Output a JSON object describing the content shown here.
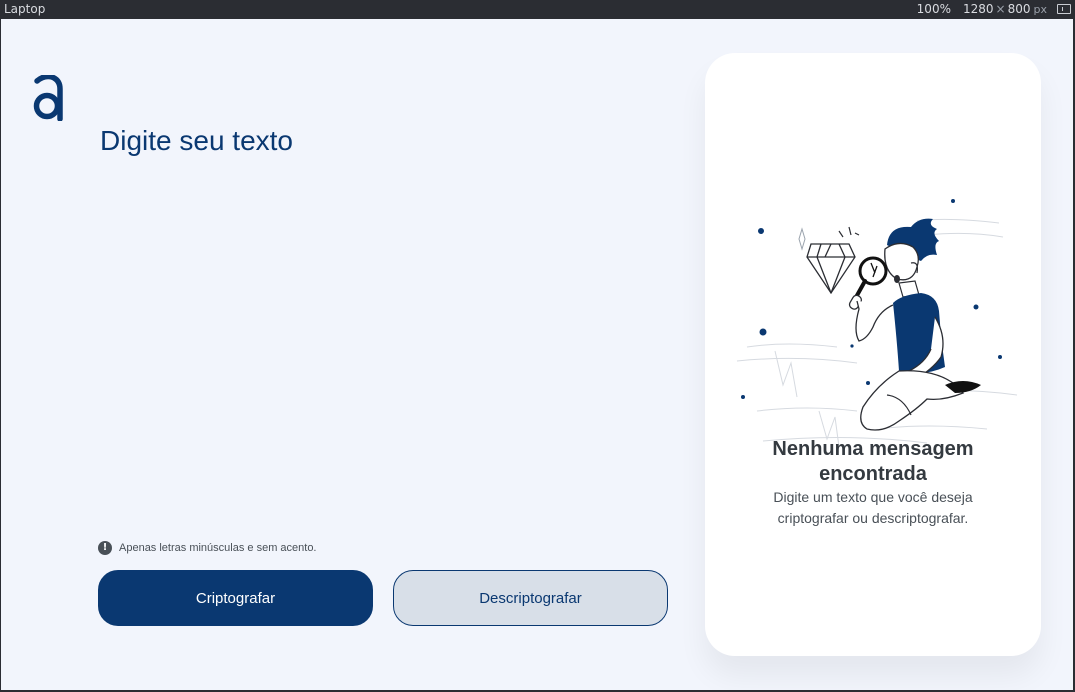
{
  "devtools": {
    "device": "Laptop",
    "zoom": "100%",
    "width": "1280",
    "times": "×",
    "height": "800",
    "unit": "px",
    "rotate_icon": "rotate-icon"
  },
  "brand": {
    "logo_icon": "alura-a-logo",
    "primary_color": "#0a3871",
    "background_color": "#f2f5fc"
  },
  "main": {
    "title": "Digite seu texto",
    "input_value": "",
    "hint_icon": "info-icon",
    "hint_icon_glyph": "!",
    "hint": "Apenas letras minúsculas e sem acento.",
    "encrypt_label": "Criptografar",
    "decrypt_label": "Descriptografar"
  },
  "output": {
    "illustration": "person-with-magnifying-glass-and-diamond",
    "title_line1": "Nenhuma mensagem",
    "title_line2": "encontrada",
    "text_line1": "Digite um texto que você deseja",
    "text_line2": "criptografar ou descriptografar."
  }
}
